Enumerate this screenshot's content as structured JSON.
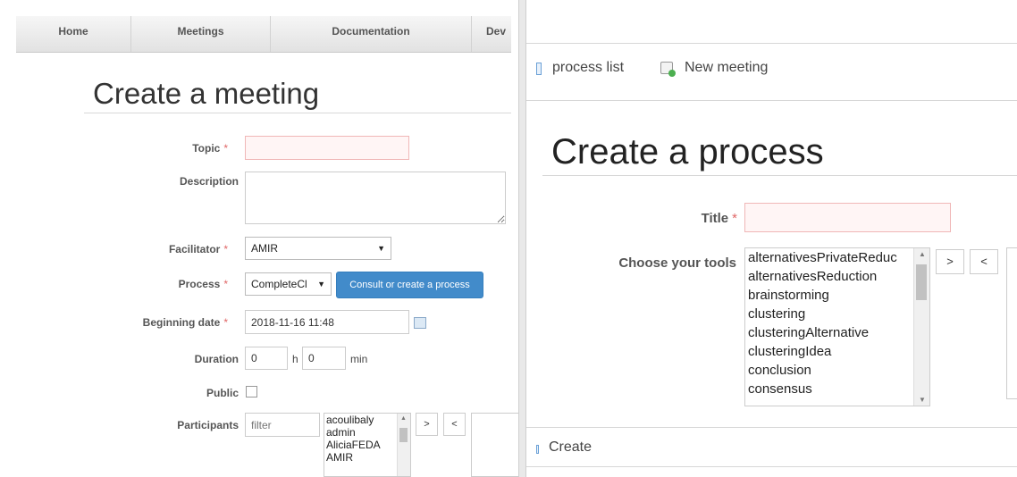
{
  "left": {
    "nav": [
      "Home",
      "Meetings",
      "Documentation",
      "Dev"
    ],
    "title": "Create a meeting",
    "topic": {
      "label": "Topic",
      "value": ""
    },
    "description": {
      "label": "Description",
      "value": ""
    },
    "facilitator": {
      "label": "Facilitator",
      "value": "AMIR"
    },
    "process": {
      "label": "Process",
      "value": "CompleteCl",
      "button": "Consult or create a process"
    },
    "beginning_date": {
      "label": "Beginning date",
      "value": "2018-11-16 11:48"
    },
    "duration": {
      "label": "Duration",
      "hours": "0",
      "h_unit": "h",
      "minutes": "0",
      "min_unit": "min"
    },
    "public": {
      "label": "Public"
    },
    "participants": {
      "label": "Participants",
      "filter_placeholder": "filter",
      "options": [
        "acoulibaly",
        "admin",
        "AliciaFEDA",
        "AMIR"
      ]
    },
    "move_right": ">",
    "move_left": "<",
    "required_mark": "*"
  },
  "right": {
    "links": {
      "process_list": "process list",
      "new_meeting": "New meeting"
    },
    "title": "Create a process",
    "title_field": {
      "label": "Title",
      "value": ""
    },
    "tools": {
      "label": "Choose your tools",
      "options": [
        "alternativesPrivateReduc",
        "alternativesReduction",
        "brainstorming",
        "clustering",
        "clusteringAlternative",
        "clusteringIdea",
        "conclusion",
        "consensus"
      ]
    },
    "move_right": ">",
    "move_left": "<",
    "create_label": "Create",
    "required_mark": "*"
  },
  "colors": {
    "accent": "#428bca",
    "required": "#e06666",
    "error_border": "#f0b7b7"
  },
  "icons": [
    "document-icon",
    "new-meeting-icon",
    "calendar-icon",
    "select-arrow-icon"
  ]
}
